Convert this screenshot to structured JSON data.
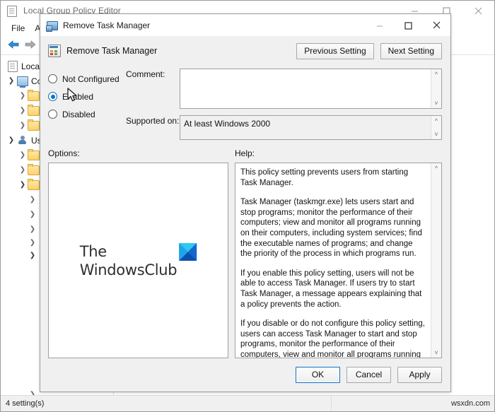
{
  "gpedit": {
    "title": "Local Group Policy Editor",
    "title_icon": "policy-document-icon",
    "menu": [
      {
        "label": "File"
      },
      {
        "label": "Act"
      }
    ],
    "toolbar": {
      "back_icon": "back-arrow-icon",
      "forward_icon": "forward-arrow-icon",
      "folder_icon": "folder-icon"
    },
    "window_controls": {
      "minimize": "minimize-icon",
      "maximize": "maximize-icon",
      "close": "close-icon"
    },
    "tree": [
      {
        "label": "Local C",
        "icon": "policy-document-icon",
        "chevron": "",
        "indent": 0
      },
      {
        "label": "Co",
        "icon": "computer-icon",
        "chevron": "v",
        "indent": 1
      },
      {
        "label": "",
        "icon": "folder-icon",
        "chevron": ">",
        "indent": 2
      },
      {
        "label": "",
        "icon": "folder-icon",
        "chevron": ">",
        "indent": 2
      },
      {
        "label": "",
        "icon": "folder-icon",
        "chevron": ">",
        "indent": 2
      },
      {
        "label": "Use",
        "icon": "user-icon",
        "chevron": "v",
        "indent": 1
      },
      {
        "label": "",
        "icon": "folder-icon",
        "chevron": ">",
        "indent": 2
      },
      {
        "label": "",
        "icon": "folder-icon",
        "chevron": ">",
        "indent": 2
      },
      {
        "label": "",
        "icon": "folder-icon",
        "chevron": "v",
        "indent": 2
      },
      {
        "label": "",
        "icon": "",
        "chevron": ">",
        "indent": 3
      },
      {
        "label": "",
        "icon": "",
        "chevron": ">",
        "indent": 3
      },
      {
        "label": "",
        "icon": "",
        "chevron": ">",
        "indent": 3
      },
      {
        "label": "",
        "icon": "",
        "chevron": ">",
        "indent": 4
      },
      {
        "label": "",
        "icon": "",
        "chevron": "v",
        "indent": 4
      }
    ],
    "tree_bottom_chevron": ">",
    "statusbar": {
      "settings_count": "4 setting(s)",
      "watermark": "wsxdn.com"
    }
  },
  "dialog": {
    "title": "Remove Task Manager",
    "title_icon": "policy-setting-icon",
    "window_controls": {
      "minimize": "minimize-icon",
      "maximize": "maximize-icon",
      "close": "close-icon"
    },
    "header": {
      "policy_icon": "policy-setting-icon",
      "policy_name": "Remove Task Manager",
      "previous_button": "Previous Setting",
      "next_button": "Next Setting"
    },
    "state": {
      "options": [
        {
          "label": "Not Configured",
          "checked": false
        },
        {
          "label": "Enabled",
          "checked": true
        },
        {
          "label": "Disabled",
          "checked": false
        }
      ],
      "selected": "Enabled"
    },
    "comment": {
      "label": "Comment:",
      "value": "",
      "placeholder": "",
      "scroll_up_icon": "chevron-up-icon",
      "scroll_down_icon": "chevron-down-icon"
    },
    "supported_on": {
      "label": "Supported on:",
      "value": "At least Windows 2000",
      "scroll_up_icon": "chevron-up-icon",
      "scroll_down_icon": "chevron-down-icon"
    },
    "options_pane": {
      "label": "Options:",
      "watermark_line1": "The",
      "watermark_line2": "WindowsClub",
      "watermark_logo": "windowsclub-logo-icon",
      "watermark_color": "#1f7ae0",
      "watermark_accent": "#2fc8f0"
    },
    "help_pane": {
      "label": "Help:",
      "scroll_up_icon": "chevron-up-icon",
      "scroll_down_icon": "chevron-down-icon",
      "paragraphs": [
        "This policy setting prevents users from starting Task Manager.",
        "Task Manager (taskmgr.exe) lets users start and stop programs; monitor the performance of their computers; view and monitor all programs running on their computers, including system services; find the executable names of programs; and change the priority of the process in which programs run.",
        "If you enable this policy setting, users will not be able to access Task Manager. If users try to start Task Manager, a message appears explaining that a policy prevents the action.",
        "If you disable or do not configure this policy setting, users can access Task Manager to  start and stop programs, monitor the performance of their computers, view and monitor all programs running on their computers, including system services, find the executable names of programs, and change the priority of the process in which programs run."
      ]
    },
    "footer": {
      "ok": "OK",
      "cancel": "Cancel",
      "apply": "Apply"
    }
  },
  "colors": {
    "accent": "#0d6fc4",
    "dialog_bg": "#f0f0f0",
    "window_bg": "#ffffff"
  },
  "cursor": {
    "name": "mouse-pointer"
  }
}
